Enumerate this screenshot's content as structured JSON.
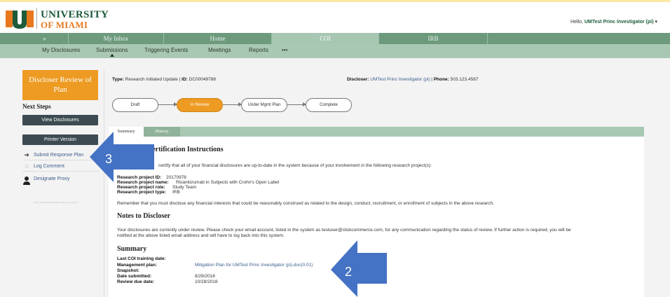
{
  "header": {
    "logo_line1": "UNIVERSITY",
    "logo_line2": "OF MIAMI",
    "greeting_prefix": "Hello, ",
    "user_name": "UMTest Princ Investigator (pi)",
    "user_caret": "▾"
  },
  "nav_primary": [
    "»",
    "My Inbox",
    "Home",
    "COI",
    "IRB"
  ],
  "nav_secondary": [
    "My Disclosures",
    "Submissions",
    "Triggering Events",
    "Meetings",
    "Reports",
    "•••"
  ],
  "sidebar": {
    "title": "Discloser Review of Plan",
    "next_steps": "Next Steps",
    "view_disclosures": "View Disclosures",
    "printer_version": "Printer Version",
    "links": [
      {
        "label": "Submit Response Plan",
        "icon": "arrow-right-icon"
      },
      {
        "label": "Log Comment",
        "icon": "comment-icon"
      },
      {
        "label": "Designate Proxy",
        "icon": "user-add-icon"
      }
    ],
    "footer": "2015. Developed 600a3d2b. All rights reserved."
  },
  "meta": {
    "type_label": "Type:",
    "type_value": "Research Initiated Update",
    "id_label": "ID:",
    "id_value": "DC00049788",
    "discloser_label": "Discloser:",
    "discloser_value": "UMTest Princ Investigator (pi)",
    "phone_label": "Phone:",
    "phone_value": "503.123.4567"
  },
  "workflow": [
    "Draft",
    "In Review",
    "Under Mgmt Plan",
    "Complete"
  ],
  "tabs": [
    "Summary",
    "History"
  ],
  "certification": {
    "heading": "Certification Instructions",
    "intro": "certify that all of your financial disclosures are up-to-date in the system because of your involvement in the following research project(s):",
    "fields": [
      {
        "k": "Research project ID:",
        "v": "20170978"
      },
      {
        "k": "Research project name:",
        "v": "Risankizumab in Subjects with Crohn's Open Label"
      },
      {
        "k": "Research project role:",
        "v": "Study Team"
      },
      {
        "k": "Research project type:",
        "v": "IRB"
      }
    ],
    "reminder": "Remember that you must disclose any financial interests that could be reasonably construed as related to the design, conduct, recruitment, or enrollment of subjects in the above research."
  },
  "notes": {
    "heading": "Notes to Discloser",
    "line1": "Your disclosures are currently under review. Please check your email account, listed in the system as testuser@clickcommerce.com, for any communication regarding the status of review. If further action is required, you will be",
    "line2": "notified at the above listed email address and will have to log back into this system."
  },
  "summary": {
    "heading": "Summary",
    "fields": [
      {
        "k": "Last COI training date:",
        "v": ""
      },
      {
        "k": "Management plan:",
        "v": "Mitigation Plan for UMTest Princ Investigator (pi).doc(0.01)"
      },
      {
        "k": "Snapshot:",
        "v": ""
      },
      {
        "k": "Date submitted:",
        "v": "8/29/2018"
      },
      {
        "k": "Review due date:",
        "v": "10/28/2018"
      }
    ]
  },
  "callouts": {
    "left": "3",
    "right": "2",
    "color": "#4472c4"
  }
}
